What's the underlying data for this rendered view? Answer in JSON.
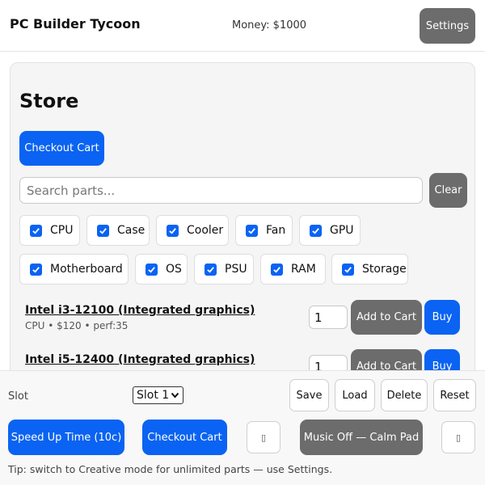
{
  "header": {
    "title": "PC Builder Tycoon",
    "money": "Money: $1000",
    "settings_label": "Settings"
  },
  "store": {
    "title": "Store",
    "checkout_label": "Checkout Cart",
    "search_placeholder": "Search parts...",
    "clear_label": "Clear",
    "filters": [
      {
        "label": "CPU",
        "checked": true
      },
      {
        "label": "Case",
        "checked": true
      },
      {
        "label": "Cooler",
        "checked": true
      },
      {
        "label": "Fan",
        "checked": true
      },
      {
        "label": "GPU",
        "checked": true
      },
      {
        "label": "Motherboard",
        "checked": true
      },
      {
        "label": "OS",
        "checked": true
      },
      {
        "label": "PSU",
        "checked": true
      },
      {
        "label": "RAM",
        "checked": true
      },
      {
        "label": "Storage",
        "checked": true
      }
    ],
    "parts": [
      {
        "name": "Intel i3-12100 (Integrated graphics)",
        "meta": "CPU • $120 • perf:35",
        "qty": "1",
        "add_label": "Add to Cart",
        "buy_label": "Buy"
      },
      {
        "name": "Intel i5-12400 (Integrated graphics)",
        "meta": "",
        "qty": "1",
        "add_label": "Add to Cart",
        "buy_label": "Buy"
      }
    ]
  },
  "bottom": {
    "slot_label": "Slot",
    "slot_value": "Slot 1",
    "save_label": "Save",
    "load_label": "Load",
    "delete_label": "Delete",
    "reset_label": "Reset",
    "speed_label": "Speed Up Time (10c)",
    "checkout_label": "Checkout Cart",
    "music_label": "Music Off — Calm Pad",
    "placeholder_glyph_1": "▯",
    "placeholder_glyph_2": "▯",
    "tip": "Tip: switch to Creative mode for unlimited parts — use Settings."
  },
  "colors": {
    "accent": "#0a63f2",
    "button_grey": "#6c6c6c",
    "panel_bg": "#f5f5f5"
  }
}
